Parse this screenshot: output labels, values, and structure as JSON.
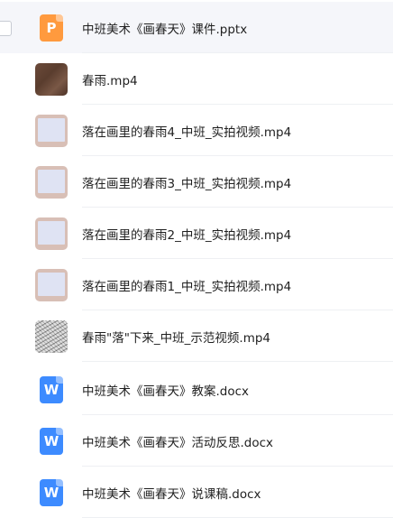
{
  "files": [
    {
      "name": "中班美术《画春天》课件.pptx",
      "type": "ppt",
      "icon_letter": "P",
      "selected": true
    },
    {
      "name": "春雨.mp4",
      "type": "video",
      "thumb": "dark"
    },
    {
      "name": "落在画里的春雨4_中班_实拍视频.mp4",
      "type": "video",
      "thumb": "frame"
    },
    {
      "name": "落在画里的春雨3_中班_实拍视频.mp4",
      "type": "video",
      "thumb": "frame"
    },
    {
      "name": "落在画里的春雨2_中班_实拍视频.mp4",
      "type": "video",
      "thumb": "frame"
    },
    {
      "name": "落在画里的春雨1_中班_实拍视频.mp4",
      "type": "video",
      "thumb": "frame"
    },
    {
      "name": "春雨\"落\"下来_中班_示范视频.mp4",
      "type": "video",
      "thumb": "noise"
    },
    {
      "name": "中班美术《画春天》教案.docx",
      "type": "word",
      "icon_letter": "W"
    },
    {
      "name": "中班美术《画春天》活动反思.docx",
      "type": "word",
      "icon_letter": "W"
    },
    {
      "name": "中班美术《画春天》说课稿.docx",
      "type": "word",
      "icon_letter": "W"
    }
  ],
  "colors": {
    "ppt_icon": "#ff9a3e",
    "word_icon": "#3d8bff",
    "selected_row_bg": "#f5f6fa"
  }
}
